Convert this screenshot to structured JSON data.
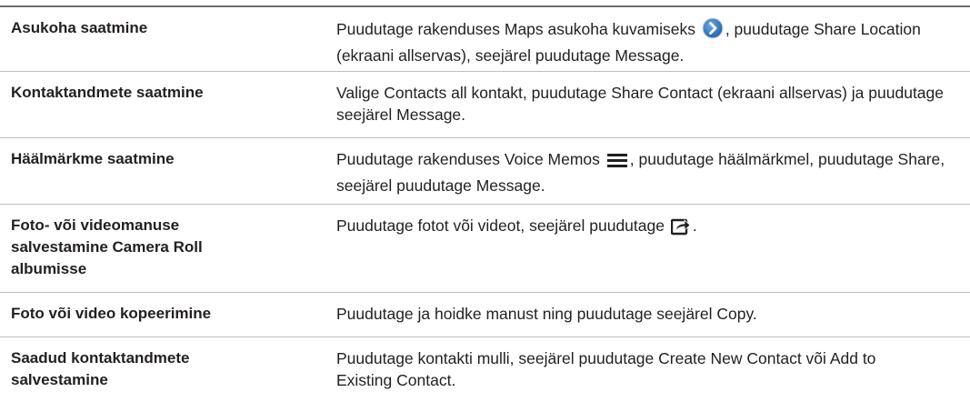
{
  "rows": [
    {
      "term": "Asukoha saatmine",
      "desc_before": "Puudutage rakenduses Maps asukoha kuvamiseks ",
      "icon": "blue-circle-arrow-icon",
      "desc_after": ", puudutage Share Location (ekraani allservas), seejärel puudutage Message."
    },
    {
      "term": "Kontaktandmete saatmine",
      "desc": "Valige Contacts all kontakt, puudutage Share Contact (ekraani allservas) ja puudutage seejärel Message."
    },
    {
      "term": "Häälmärkme saatmine",
      "desc_before": "Puudutage rakenduses Voice Memos ",
      "icon": "list-icon",
      "desc_after": ", puudutage häälmärkmel, puudutage Share, seejärel puudutage Message."
    },
    {
      "term": "Foto- või videomanuse salvestamine Camera Roll albumisse",
      "desc_before": "Puudutage fotot või videot, seejärel puudutage ",
      "icon": "share-arrow-icon",
      "desc_after": "."
    },
    {
      "term": "Foto või video kopeerimine",
      "desc": "Puudutage ja hoidke manust ning puudutage seejärel Copy."
    },
    {
      "term": "Saadud kontaktandmete salvestamine",
      "desc": "Puudutage kontakti mulli, seejärel puudutage Create New Contact või Add to Existing Contact."
    }
  ]
}
